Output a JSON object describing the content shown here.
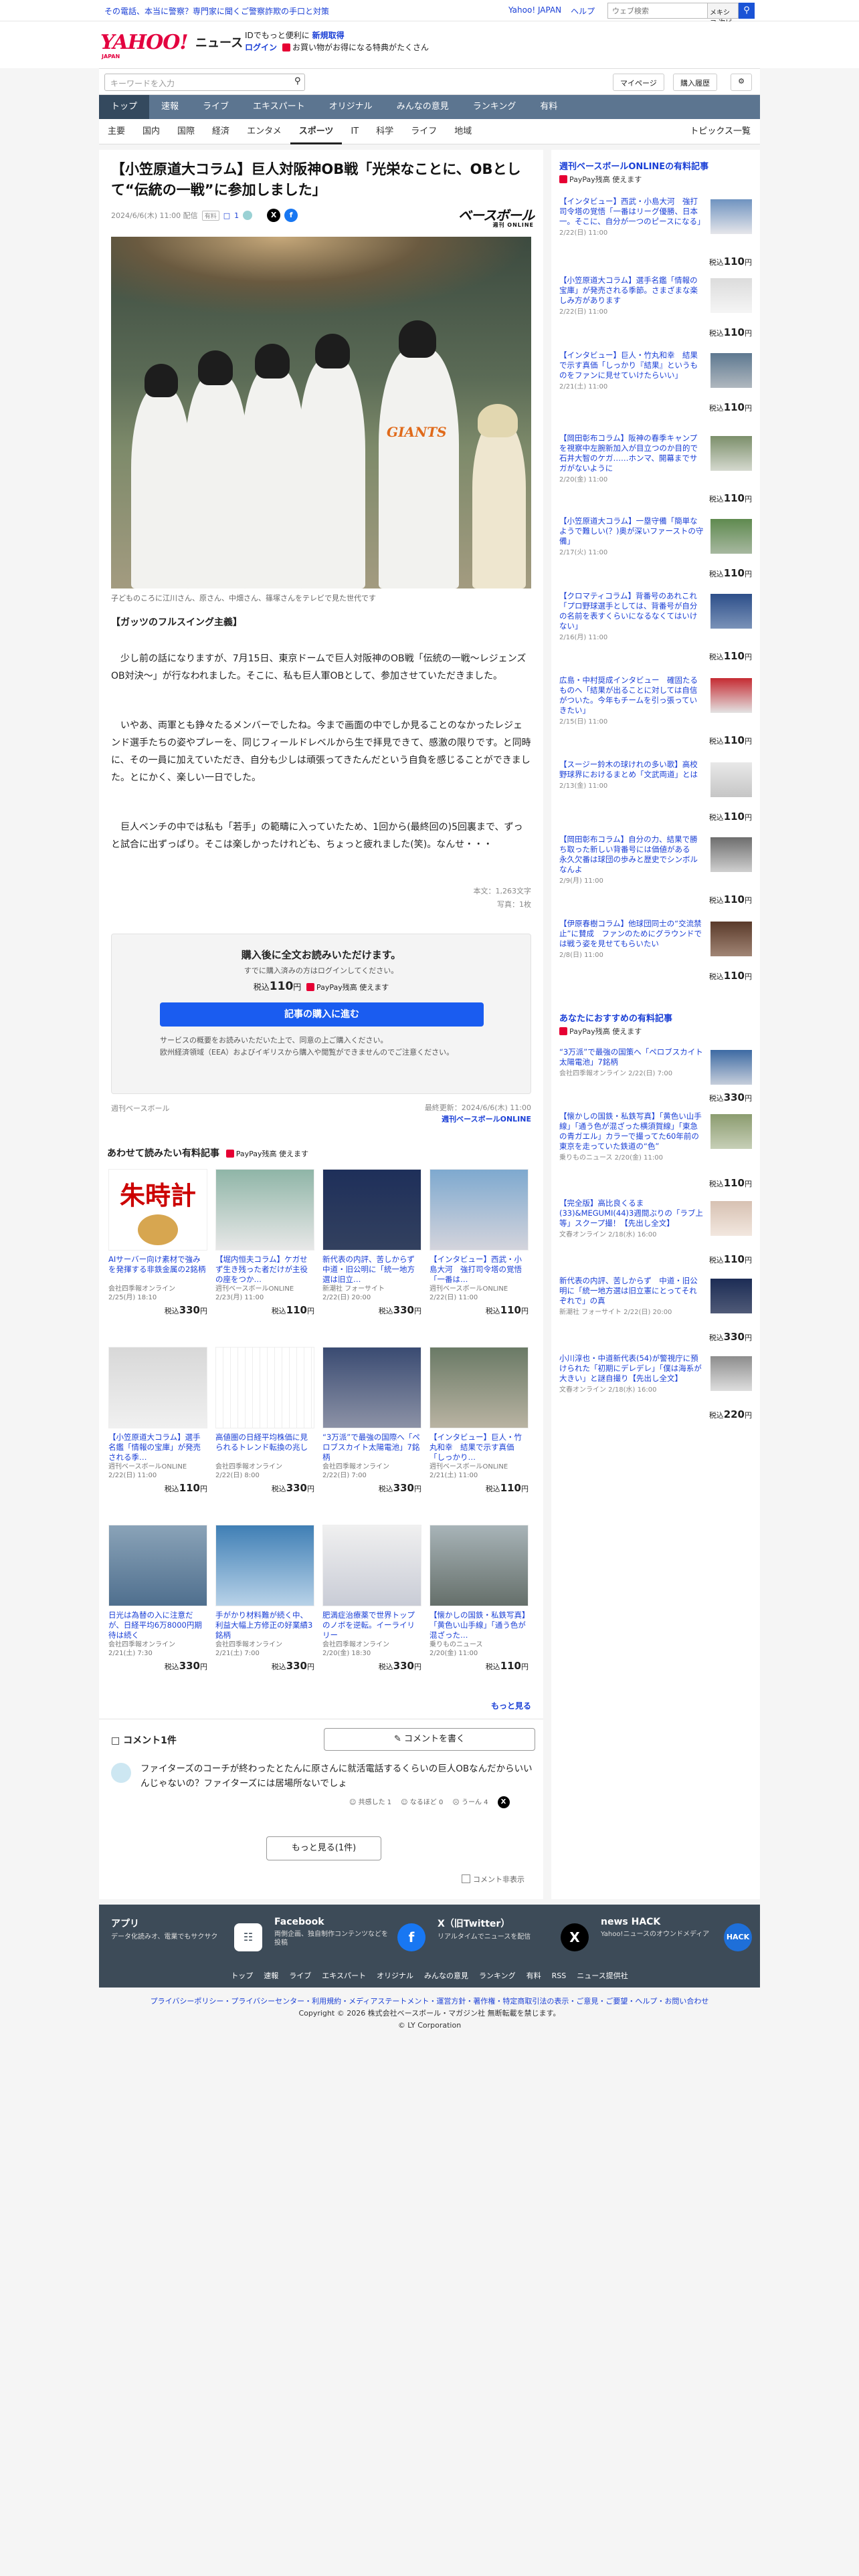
{
  "topbar": {
    "promo": "その電話、本当に警察？専門家に聞くご警察詐欺の手口と対策",
    "links": [
      "Yahoo! JAPAN",
      "ヘルプ"
    ],
    "search_placeholder": "ウェブ検索",
    "search_scope": "メキシコ 次ピ",
    "search_icon": "search-icon"
  },
  "header": {
    "logo": "YAHOO!",
    "logo_sub": "JAPAN",
    "service": "ニュース",
    "line1_prefix": "IDでもっと便利に",
    "line1_link": "新規取得",
    "login": "ログイン",
    "line2": "お買い物がお得になる特典がたくさん"
  },
  "searchbar": {
    "placeholder": "キーワードを入力",
    "mypage": "マイページ",
    "history": "購入履歴"
  },
  "nav": [
    "トップ",
    "速報",
    "ライブ",
    "エキスパート",
    "オリジナル",
    "みんなの意見",
    "ランキング",
    "有料"
  ],
  "subnav": [
    "主要",
    "国内",
    "国際",
    "経済",
    "エンタメ",
    "スポーツ",
    "IT",
    "科学",
    "ライフ",
    "地域"
  ],
  "subnav_right": "トピックス一覧",
  "article": {
    "title": "【小笠原道大コラム】巨人対阪神OB戦「光栄なことに、OBとして“伝統の一戦”に参加しました」",
    "date": "2024/6/6(木) 11:00 配信",
    "tag": "有料",
    "comment_count": "1",
    "brand": "ベースボール",
    "brand_sub": "週刊 ONLINE",
    "caption": "子どものころに江川さん、原さん、中畑さん、篠塚さんをテレビで見た世代です",
    "heading": "【ガッツのフルスイング主義】",
    "para1": "　少し前の話になりますが、7月15日、東京ドームで巨人対阪神のOB戦「伝統の一戦〜レジェンズOB対決〜」が行なわれました。そこに、私も巨人軍OBとして、参加させていただきました。",
    "para2": "　いやあ、両軍とも錚々たるメンバーでしたね。今まで画面の中でしか見ることのなかったレジェンド選手たちの姿やプレーを、同じフィールドレベルから生で拝見できて、感激の限りです。と同時に、その一員に加えていただき、自分も少しは頑張ってきたんだという自負を感じることができました。とにかく、楽しい一日でした。",
    "para3": "　巨人ベンチの中では私も「若手」の範疇に入っていたため、1回から(最終回の)5回裏まで、ずっと試合に出ずっぱり。そこは楽しかったけれども、ちょっと疲れました(笑)。なんせ・・・",
    "chars": "本文：1,263文字",
    "photos": "写真：1枚",
    "paywall": {
      "title": "購入後に全文お読みいただけます。",
      "already": "すでに購入済みの方はログインしてください。",
      "price_prefix": "税込",
      "price": "110",
      "price_suffix": "円",
      "paypay": "PayPay残高 使えます",
      "buy": "記事の購入に進む",
      "note1": "サービスの概要をお読みいただいた上で、同意の上ご購入ください。",
      "note2": "欧州経済領域（EEA）およびイギリスから購入や閲覧ができませんのでご注意ください。"
    },
    "source": "週刊ベースボール",
    "updated": "最終更新：2024/6/6(木) 11:00",
    "updated_by": "週刊ベースボールONLINE"
  },
  "related": {
    "title": "あわせて読みたい有料記事",
    "paypay": "PayPay残高 使えます",
    "more": "もっと見る",
    "items": [
      {
        "title": "AIサーバー向け素材で強みを発揮する非鉄金属の2銘柄",
        "by": "会社四季報オンライン",
        "date": "2/25(月) 18:10",
        "price": "330"
      },
      {
        "title": "【堀内恒夫コラム】ケガせず生き残った者だけが主役の座をつか…",
        "by": "週刊ベースボールONLINE",
        "date": "2/23(月) 11:00",
        "price": "110"
      },
      {
        "title": "新代表の内評、苦しからず　中道・旧公明に「統一地方選は旧立…",
        "by": "新潮社 フォーサイト",
        "date": "2/22(日) 20:00",
        "price": "330"
      },
      {
        "title": "【インタビュー】西武・小島大河　強打司令塔の覚悟「一番は…",
        "by": "週刊ベースボールONLINE",
        "date": "2/22(日) 11:00",
        "price": "110"
      },
      {
        "title": "【小笠原道大コラム】選手名鑑「情報の宝庫」が発売される季…",
        "by": "週刊ベースボールONLINE",
        "date": "2/22(日) 11:00",
        "price": "110"
      },
      {
        "title": "高値圏の日経平均株価に見られるトレンド転換の兆し",
        "by": "会社四季報オンライン",
        "date": "2/22(日) 8:00",
        "price": "330"
      },
      {
        "title": "“3万派”で最強の国際へ「ペロブスカイト太陽電池」7銘柄",
        "by": "会社四季報オンライン",
        "date": "2/22(日) 7:00",
        "price": "330"
      },
      {
        "title": "【インタビュー】巨人・竹丸和幸　結果で示す真価「しっかり…",
        "by": "週刊ベースボールONLINE",
        "date": "2/21(土) 11:00",
        "price": "110"
      },
      {
        "title": "日光は為替の入に注意だが、日経平均6万8000円期待は続く",
        "by": "会社四季報オンライン",
        "date": "2/21(土) 7:30",
        "price": "330"
      },
      {
        "title": "手がかり材料難が続く中、利益大幅上方修正の好業績3銘柄",
        "by": "会社四季報オンライン",
        "date": "2/21(土) 7:00",
        "price": "330"
      },
      {
        "title": "肥満症治療薬で世界トップのノボを逆転。イーライリリー",
        "by": "会社四季報オンライン",
        "date": "2/20(金) 18:30",
        "price": "330"
      },
      {
        "title": "【懐かしの国鉄・私鉄写真】「黄色い山手線」「通う色が混ざった…",
        "by": "乗りものニュース",
        "date": "2/20(金) 11:00",
        "price": "110"
      }
    ]
  },
  "comments": {
    "title": "コメント1件",
    "write": "コメントを書く",
    "text": "ファイターズのコーチが終わったとたんに原さんに就活電話するくらいの巨人OBなんだからいいんじゃないの？ファイターズには居場所ないでしょ",
    "reactions": [
      {
        "label": "共感した",
        "count": "1"
      },
      {
        "label": "なるほど",
        "count": "0"
      },
      {
        "label": "うーん",
        "count": "4"
      }
    ],
    "more": "もっと見る(1件)",
    "hide": "コメント非表示"
  },
  "side": {
    "sec1_title": "週刊ベースボールONLINEの有料記事",
    "sec1_paypay": "PayPay残高 使えます",
    "sec1": [
      {
        "title": "【インタビュー】西武・小島大河　強打司令塔の覚悟「一番はリーグ優勝、日本一。そこに、自分が一つのピースになる」",
        "date": "2/22(日) 11:00",
        "price": "110"
      },
      {
        "title": "【小笠原道大コラム】選手名鑑「情報の宝庫」が発売される季節。さまざまな楽しみ方があります",
        "date": "2/22(日) 11:00",
        "price": "110"
      },
      {
        "title": "【インタビュー】巨人・竹丸和幸　結果で示す真価「しっかり『結果』というものをファンに見せていけたらいい」",
        "date": "2/21(土) 11:00",
        "price": "110"
      },
      {
        "title": "【岡田彰布コラム】阪神の春季キャンプを視察中左腕新加入が目立つのか目的で石井大智のケガ……ホンマ、開幕までサガがないように",
        "date": "2/20(金) 11:00",
        "price": "110"
      },
      {
        "title": "【小笠原道大コラム】一塁守備「簡単なようで難しい(？)奥が深いファーストの守備」",
        "date": "2/17(火) 11:00",
        "price": "110"
      },
      {
        "title": "【クロマティコラム】背番号のあれこれ「プロ野球選手としては、背番号が自分の名前を表すくらいになるなくてはいけない」",
        "date": "2/16(月) 11:00",
        "price": "110"
      },
      {
        "title": "広島・中村奨成インタビュー　確固たるものへ「結果が出ることに対しては自信がついた。今年もチームを引っ張っていきたい」",
        "date": "2/15(日) 11:00",
        "price": "110"
      },
      {
        "title": "【スージー鈴木の球けれの多い歌】高校野球界におけるまとめ「文武両道」とは",
        "date": "2/13(金) 11:00",
        "price": "110"
      },
      {
        "title": "【岡田彰布コラム】自分の力、結果で勝ち取った新しい背番号には価値がある　永久欠番は球団の歩みと歴史でシンボルなんよ",
        "date": "2/9(月) 11:00",
        "price": "110"
      },
      {
        "title": "【伊原春樹コラム】他球団同士の“交流禁止”に賛成　ファンのためにグラウンドでは戦う姿を見せてもらいたい",
        "date": "2/8(日) 11:00",
        "price": "110"
      }
    ],
    "sec2_title": "あなたにおすすめの有料記事",
    "sec2_paypay": "PayPay残高 使えます",
    "sec2": [
      {
        "title": "“3万派”で最強の国策へ「ペロブスカイト太陽電池」7銘柄",
        "date": "会社四季報オンライン 2/22(日) 7:00",
        "price": "330"
      },
      {
        "title": "【懐かしの国鉄・私鉄写真】「黄色い山手線」「通う色が混ざった横須賀線」「東急の青ガエル」カラーで撮ってた60年前の東京を走っていた鉄道の“色”",
        "date": "乗りものニュース 2/20(金) 11:00",
        "price": "110"
      },
      {
        "title": "【完全版】高比良くるま(33)&MEGUMI(44)3週間ぶりの「ラブ上等」スクープ撮！【先出し全文】",
        "date": "文春オンライン 2/18(水) 16:00",
        "price": "110"
      },
      {
        "title": "新代表の内評、苦しからず　中道・旧公明に「統一地方選は旧立憲にとってそれぞれで」の真",
        "date": "新潮社 フォーサイト 2/22(日) 20:00",
        "price": "330"
      },
      {
        "title": "小川淳也・中道新代表(54)が警視庁に預けられた「初期にデレデレ」「僕は海系が大きい」と謎自撮り【先出し全文】",
        "date": "文春オンライン 2/18(水) 16:00",
        "price": "220"
      }
    ]
  },
  "footer": {
    "cols": [
      {
        "h": "アプリ",
        "d": "データ化読みオ、電業でもサクサク"
      },
      {
        "h": "Facebook",
        "d": "両側企画、独自制作コンテンツなどを投稿"
      },
      {
        "h": "X（旧Twitter）",
        "d": "リアルタイムでニュースを配信"
      },
      {
        "h": "news HACK",
        "d": "Yahoo!ニュースのオウンドメディア"
      }
    ],
    "nav": [
      "トップ",
      "速報",
      "ライブ",
      "エキスパート",
      "オリジナル",
      "みんなの意見",
      "ランキング",
      "有料",
      "RSS",
      "ニュース提供社"
    ],
    "legal1": "プライバシーポリシー・プライバシーセンター・利用規約・メディアステートメント・運営方針・著作権・特定商取引法の表示・ご意見・ご要望・ヘルプ・お問い合わせ",
    "legal2": "Copyright © 2026 株式会社ベースボール・マガジン社 無断転載を禁じます。",
    "legal3": "© LY Corporation"
  }
}
